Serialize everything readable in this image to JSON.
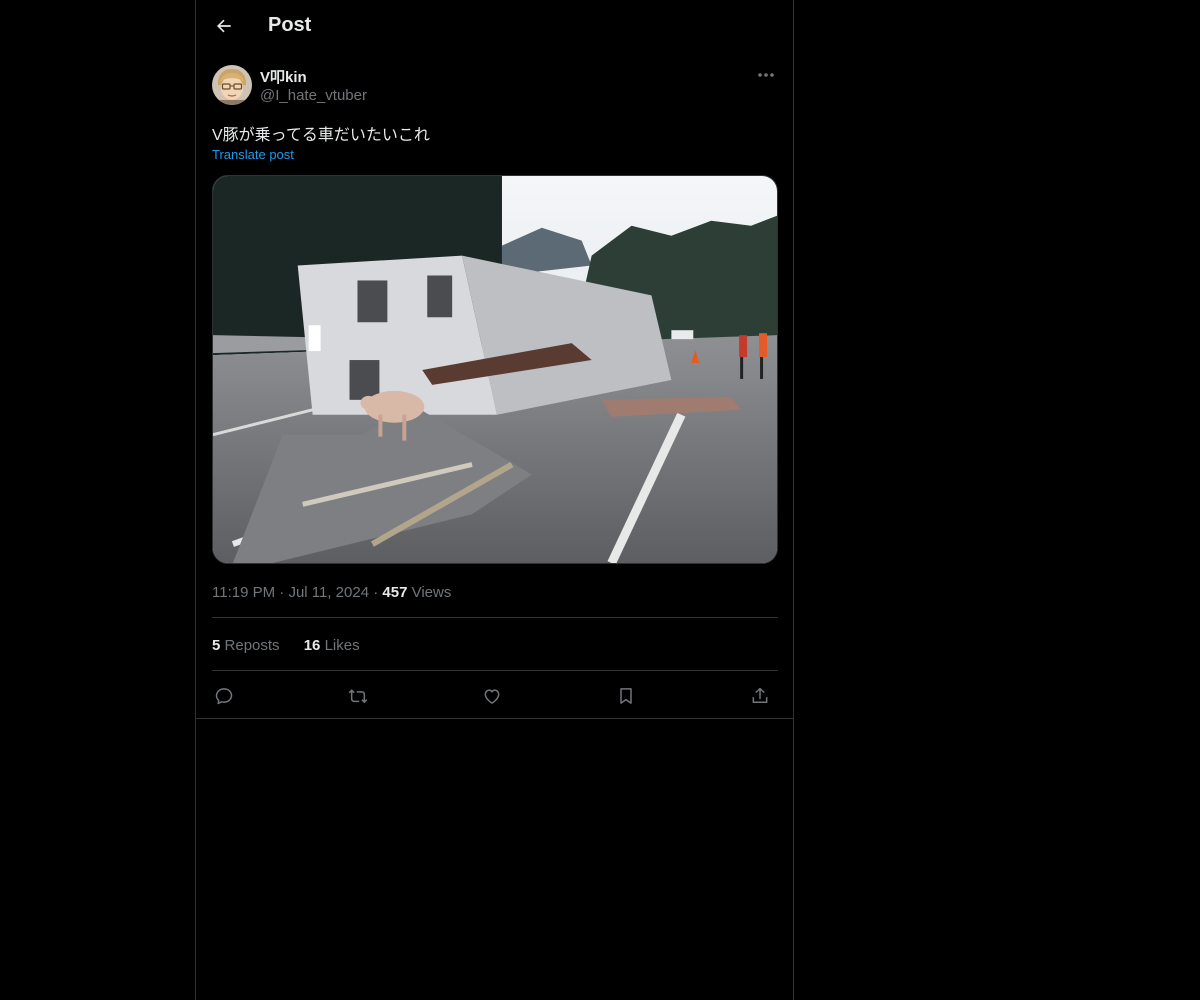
{
  "header": {
    "title": "Post"
  },
  "post": {
    "author_name": "V叩kin",
    "author_handle": "@I_hate_vtuber",
    "text": "V豚が乗ってる車だいたいこれ",
    "translate_label": "Translate post",
    "time": "11:19 PM",
    "date": "Jul 11, 2024",
    "views_count": "457",
    "views_label": "Views",
    "reposts_count": "5",
    "reposts_label": "Reposts",
    "likes_count": "16",
    "likes_label": "Likes"
  },
  "icons": {
    "back": "arrow-left-icon",
    "more": "more-icon",
    "reply": "reply-icon",
    "repost": "repost-icon",
    "like": "heart-icon",
    "bookmark": "bookmark-icon",
    "share": "share-icon"
  },
  "colors": {
    "background": "#000000",
    "text": "#e7e9ea",
    "secondary": "#71767b",
    "accent": "#1d9bf0",
    "border": "#2f3336"
  }
}
